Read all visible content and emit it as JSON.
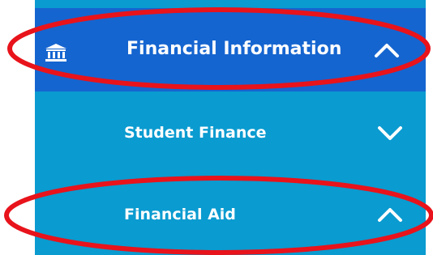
{
  "menu": {
    "primary": {
      "label": "Financial Information",
      "icon": "bank-icon",
      "state_icon": "chevron-up-icon"
    },
    "items": [
      {
        "label": "Student Finance",
        "state_icon": "chevron-down-icon"
      },
      {
        "label": "Financial Aid",
        "state_icon": "chevron-up-icon"
      }
    ]
  },
  "annotations": {
    "highlight_color": "#e8131b"
  },
  "colors": {
    "primary_bg": "#1565d0",
    "submenu_bg": "#0a9bd0",
    "text": "#ffffff"
  }
}
